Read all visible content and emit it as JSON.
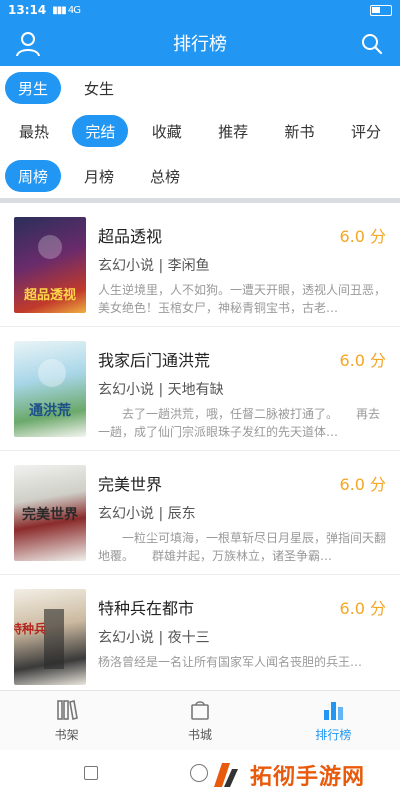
{
  "status_bar": {
    "time": "13:14",
    "signal": "4G"
  },
  "header": {
    "title": "排行榜",
    "left_icon": "user-icon",
    "right_icon": "search-icon"
  },
  "filters": {
    "gender": [
      {
        "label": "男生",
        "active": true
      },
      {
        "label": "女生",
        "active": false
      }
    ],
    "type": [
      {
        "label": "最热",
        "active": false
      },
      {
        "label": "完结",
        "active": true
      },
      {
        "label": "收藏",
        "active": false
      },
      {
        "label": "推荐",
        "active": false
      },
      {
        "label": "新书",
        "active": false
      },
      {
        "label": "评分",
        "active": false
      }
    ],
    "period": [
      {
        "label": "周榜",
        "active": true
      },
      {
        "label": "月榜",
        "active": false
      },
      {
        "label": "总榜",
        "active": false
      }
    ]
  },
  "books": [
    {
      "title": "超品透视",
      "score": "6.0 分",
      "category": "玄幻小说",
      "author": "李闲鱼",
      "desc": "人生逆境里，人不如狗。一遭天开眼，透视人间丑恶，美女绝色！玉棺女尸，神秘青铜宝书，古老…",
      "cover_text": "超品透视"
    },
    {
      "title": "我家后门通洪荒",
      "score": "6.0 分",
      "category": "玄幻小说",
      "author": "天地有缺",
      "desc": "　　去了一趟洪荒，哦，任督二脉被打通了。　　再去一趟，成了仙门宗派眼珠子发红的先天道体…",
      "cover_text": "通洪荒"
    },
    {
      "title": "完美世界",
      "score": "6.0 分",
      "category": "玄幻小说",
      "author": "辰东",
      "desc": "　　一粒尘可填海，一根草斩尽日月星辰，弹指间天翻地覆。　　群雄并起，万族林立，诸圣争霸…",
      "cover_text": "完美世界"
    },
    {
      "title": "特种兵在都市",
      "score": "6.0 分",
      "category": "玄幻小说",
      "author": "夜十三",
      "desc": "杨洛曾经是一名让所有国家军人闻名丧胆的兵王…",
      "cover_text": "特种兵"
    }
  ],
  "bottom_nav": [
    {
      "label": "书架",
      "icon": "bookshelf-icon",
      "active": false
    },
    {
      "label": "书城",
      "icon": "bag-icon",
      "active": false
    },
    {
      "label": "排行榜",
      "icon": "ranking-icon",
      "active": true
    }
  ],
  "watermark": {
    "text": "拓彻手游网"
  },
  "colors": {
    "primary": "#2196f3",
    "score": "#f5a623",
    "divider": "#d9dde2"
  }
}
